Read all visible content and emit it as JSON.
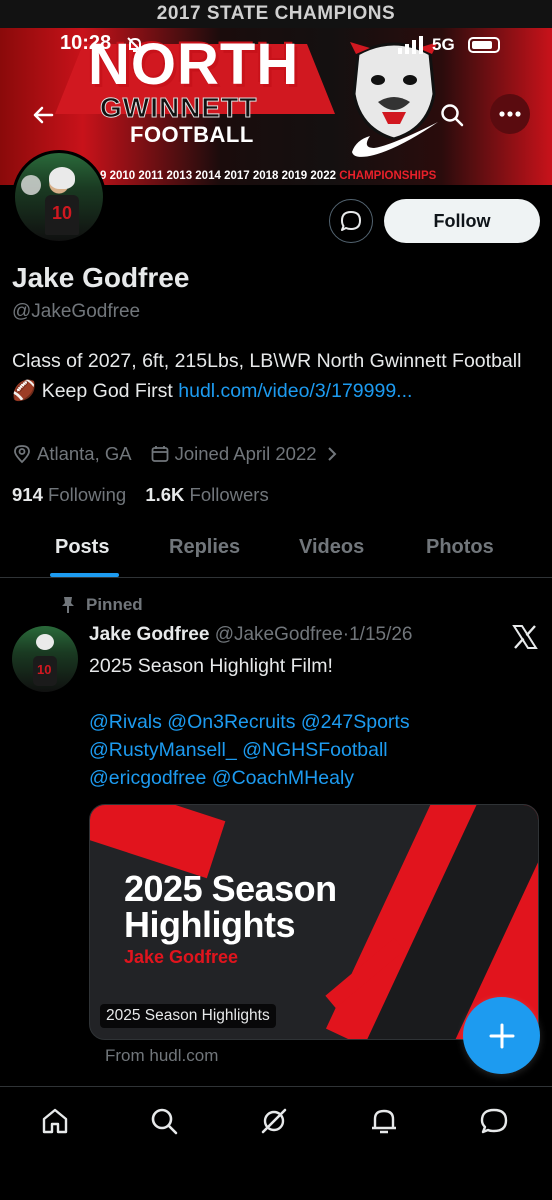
{
  "status_bar": {
    "time": "10:28",
    "network": "5G"
  },
  "banner": {
    "headline": "2017 STATE CHAMPIONS",
    "school_line1": "NORTH",
    "school_line2": "GWINNETT",
    "school_line3": "FOOTBALL",
    "years": "9 2010 2011 2013 2014 2017 2018 2019 2022 ",
    "years_suffix": "CHAMPIONSHIPS"
  },
  "profile": {
    "name": "Jake Godfree",
    "handle": "@JakeGodfree",
    "bio_text": "Class of 2027, 6ft, 215Lbs, LB\\WR North Gwinnett Football 🏈 Keep God First ",
    "bio_link": "hudl.com/video/3/179999...",
    "location": "Atlanta, GA",
    "joined": "Joined April 2022",
    "following_count": "914",
    "following_label": "Following",
    "followers_count": "1.6K",
    "followers_label": "Followers",
    "follow_button": "Follow",
    "avatar_number": "10"
  },
  "tabs": [
    "Posts",
    "Replies",
    "Videos",
    "Photos"
  ],
  "post": {
    "pinned_label": "Pinned",
    "author_name": "Jake Godfree",
    "author_handle": "@JakeGodfree",
    "separator": "·",
    "date": "1/15/26",
    "text": "2025 Season Highlight Film!",
    "mentions_line1": "@Rivals @On3Recruits @247Sports",
    "mentions_line2": "@RustyMansell_ @NGHSFootball",
    "mentions_line3": "@ericgodfree @CoachMHealy",
    "media_title_line1": "2025 Season",
    "media_title_line2": "Highlights",
    "media_subtitle": "Jake Godfree",
    "media_badge": "2025 Season Highlights",
    "source": "From hudl.com"
  },
  "icons": {
    "back": "arrow-left-icon",
    "search": "search-icon",
    "more": "more-icon",
    "message": "message-icon",
    "compose": "plus-icon"
  },
  "colors": {
    "accent": "#1d9bf0",
    "banner_red": "#d11820",
    "background": "#000000"
  }
}
